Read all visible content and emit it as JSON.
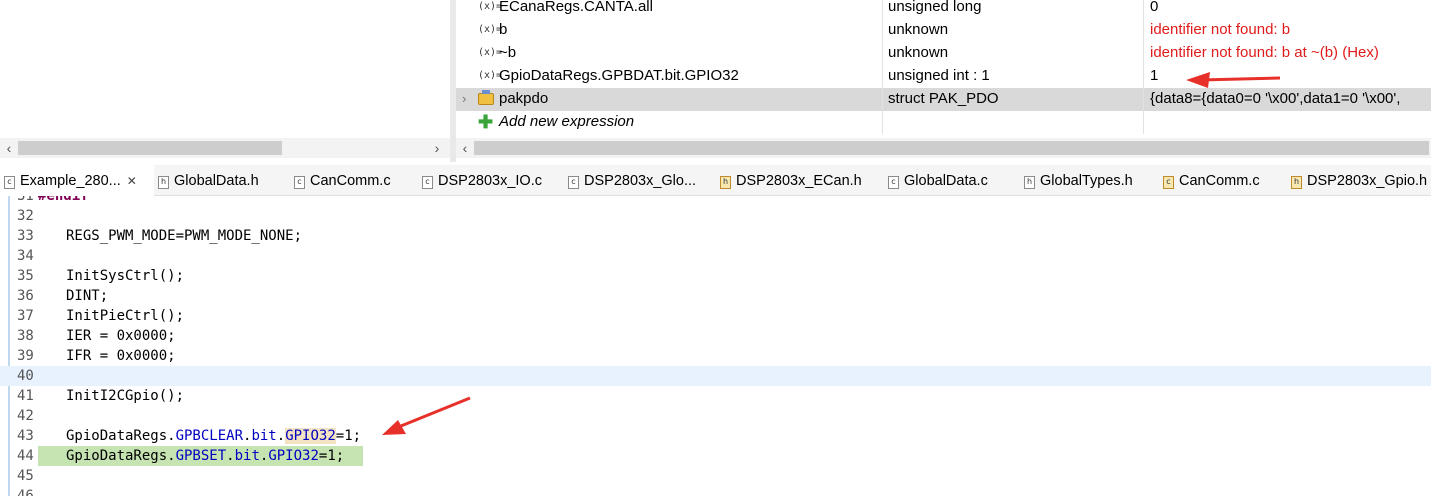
{
  "expressions": {
    "rows": [
      {
        "name": "ECanaRegs.CANTA.all",
        "type": "unsigned long",
        "value": "0",
        "error": false
      },
      {
        "name": "b",
        "type": "unknown",
        "value": "identifier not found: b",
        "error": true
      },
      {
        "name": "~b",
        "type": "unknown",
        "value": "identifier not found: b at ~(b) (Hex)",
        "error": true
      },
      {
        "name": "GpioDataRegs.GPBDAT.bit.GPIO32",
        "type": "unsigned int : 1",
        "value": "1",
        "error": false
      },
      {
        "name": "pakpdo",
        "type": "struct PAK_PDO",
        "value": "{data8={data0=0 '\\x00',data1=0 '\\x00',",
        "error": false
      }
    ],
    "add_label": "Add new expression",
    "var_icon": "(x)="
  },
  "tabs": [
    {
      "label": "Example_280...",
      "icon": "c",
      "active": true
    },
    {
      "label": "GlobalData.h",
      "icon": "h"
    },
    {
      "label": "CanComm.c",
      "icon": "c"
    },
    {
      "label": "DSP2803x_IO.c",
      "icon": "c"
    },
    {
      "label": "DSP2803x_Glo...",
      "icon": "c"
    },
    {
      "label": "DSP2803x_ECan.h",
      "icon": "h"
    },
    {
      "label": "GlobalData.c",
      "icon": "c"
    },
    {
      "label": "GlobalTypes.h",
      "icon": "h"
    },
    {
      "label": "CanComm.c",
      "icon": "c"
    },
    {
      "label": "DSP2803x_Gpio.h",
      "icon": "h"
    }
  ],
  "code": {
    "partial_top": "#endif",
    "lines": [
      {
        "n": "32",
        "text": ""
      },
      {
        "n": "33",
        "text": "REGS_PWM_MODE=PWM_MODE_NONE;"
      },
      {
        "n": "34",
        "text": ""
      },
      {
        "n": "35",
        "text": "InitSysCtrl();"
      },
      {
        "n": "36",
        "text": "DINT;"
      },
      {
        "n": "37",
        "text": "InitPieCtrl();"
      },
      {
        "n": "38",
        "text": "IER = 0x0000;"
      },
      {
        "n": "39",
        "text": "IFR = 0x0000;"
      },
      {
        "n": "40",
        "text": ""
      },
      {
        "n": "41",
        "text": "InitI2CGpio();"
      },
      {
        "n": "42",
        "text": ""
      },
      {
        "n": "43",
        "text": ""
      },
      {
        "n": "44",
        "text": ""
      },
      {
        "n": "45",
        "text": ""
      },
      {
        "n": "46",
        "text": ""
      }
    ],
    "line43": {
      "a": "GpioDataRegs.",
      "b": "GPBCLEAR",
      "c": ".",
      "d": "bit",
      "e": ".",
      "f": "GPIO32",
      "g": "=1;"
    },
    "line44": {
      "a": "GpioDataRegs.",
      "b": "GPBSET",
      "c": ".",
      "d": "bit",
      "e": ".",
      "f": "GPIO32",
      "g": "=1;"
    }
  },
  "colors": {
    "error": "#e01b1b",
    "keyword": "#7f0055",
    "field": "#0000c0",
    "arrow": "#e8302a",
    "breakpoint_line": "#c6e3b2"
  }
}
